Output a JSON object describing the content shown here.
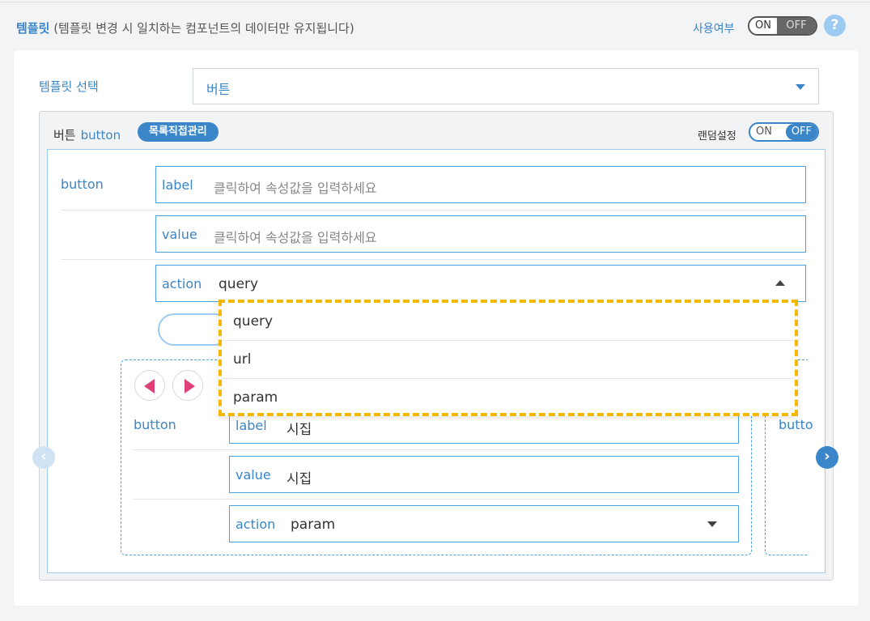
{
  "header": {
    "title": "템플릿",
    "subtitle": "(템플릿 변경 시 일치하는 컴포넌트의 데이터만 유지됩니다)",
    "use_label": "사용여부",
    "toggle_on": "ON",
    "toggle_off": "OFF",
    "help": "?"
  },
  "template_select": {
    "label": "템플릿 선택",
    "value": "버튼"
  },
  "panel": {
    "title": "버튼",
    "title_en": "button",
    "badge": "목록직접관리",
    "random_label": "랜덤설정",
    "random_on": "ON",
    "random_off": "OFF"
  },
  "editor": {
    "row_label": "button",
    "label_key": "label",
    "label_placeholder": "클릭하여 속성값을 입력하세요",
    "value_key": "value",
    "value_placeholder": "클릭하여 속성값을 입력하세요",
    "action_key": "action",
    "action_value": "query"
  },
  "dropdown": {
    "options": [
      "query",
      "url",
      "param"
    ]
  },
  "card_item": {
    "row_label": "button",
    "label_key": "label",
    "label_value": "시집",
    "value_key": "value",
    "value_value": "시집",
    "action_key": "action",
    "action_value": "param"
  },
  "card_item_next": {
    "row_label": "butto"
  },
  "nav": {
    "prev": "‹",
    "next": "›"
  },
  "colors": {
    "accent": "#3a86c8",
    "highlight": "#f5b800",
    "arrow": "#e0407a"
  }
}
